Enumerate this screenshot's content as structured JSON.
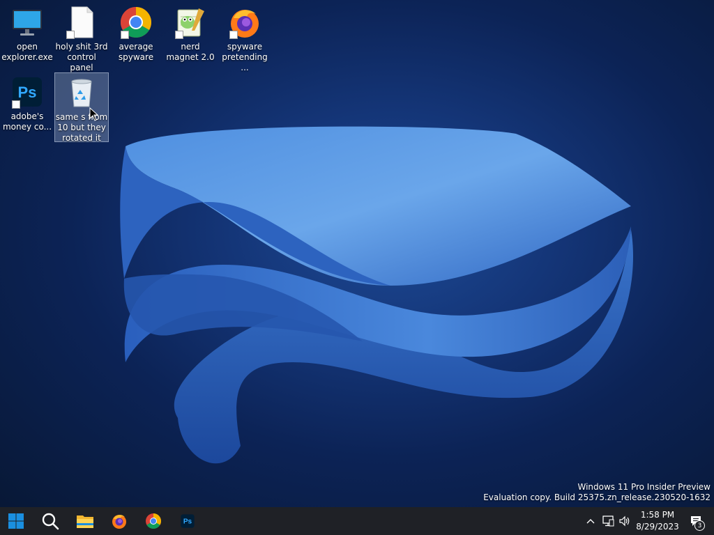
{
  "desktop": {
    "icons": [
      {
        "label": "open explorer.exe",
        "icon": "monitor-icon"
      },
      {
        "label": "holy shit 3rd control panel",
        "icon": "blank-file-icon"
      },
      {
        "label": "average spyware",
        "icon": "chrome-icon"
      },
      {
        "label": "nerd magnet 2.0",
        "icon": "notepad-plus-plus-icon"
      },
      {
        "label": "spyware pretending ...",
        "icon": "firefox-icon"
      },
      {
        "label": "adobe's money co...",
        "icon": "photoshop-icon"
      },
      {
        "label": "same s from 10 but they rotated it",
        "icon": "recycle-bin-icon"
      }
    ],
    "selected_icon": "recycle-bin"
  },
  "watermark": {
    "line1": "Windows 11 Pro Insider Preview",
    "line2": "Evaluation copy. Build 25375.zn_release.230520-1632"
  },
  "taskbar": {
    "apps": [
      "start-icon",
      "search-icon",
      "file-explorer-icon",
      "firefox-icon",
      "chrome-icon",
      "photoshop-icon"
    ],
    "tray": {
      "time": "1:58 PM",
      "date": "8/29/2023",
      "notifications": "3"
    }
  },
  "colors": {
    "taskbar_bg": "#1f2126",
    "wallpaper_bg": "#0c2356",
    "bloom_blue": "#3b7ad0",
    "start_blue": "#1a8fe0"
  }
}
